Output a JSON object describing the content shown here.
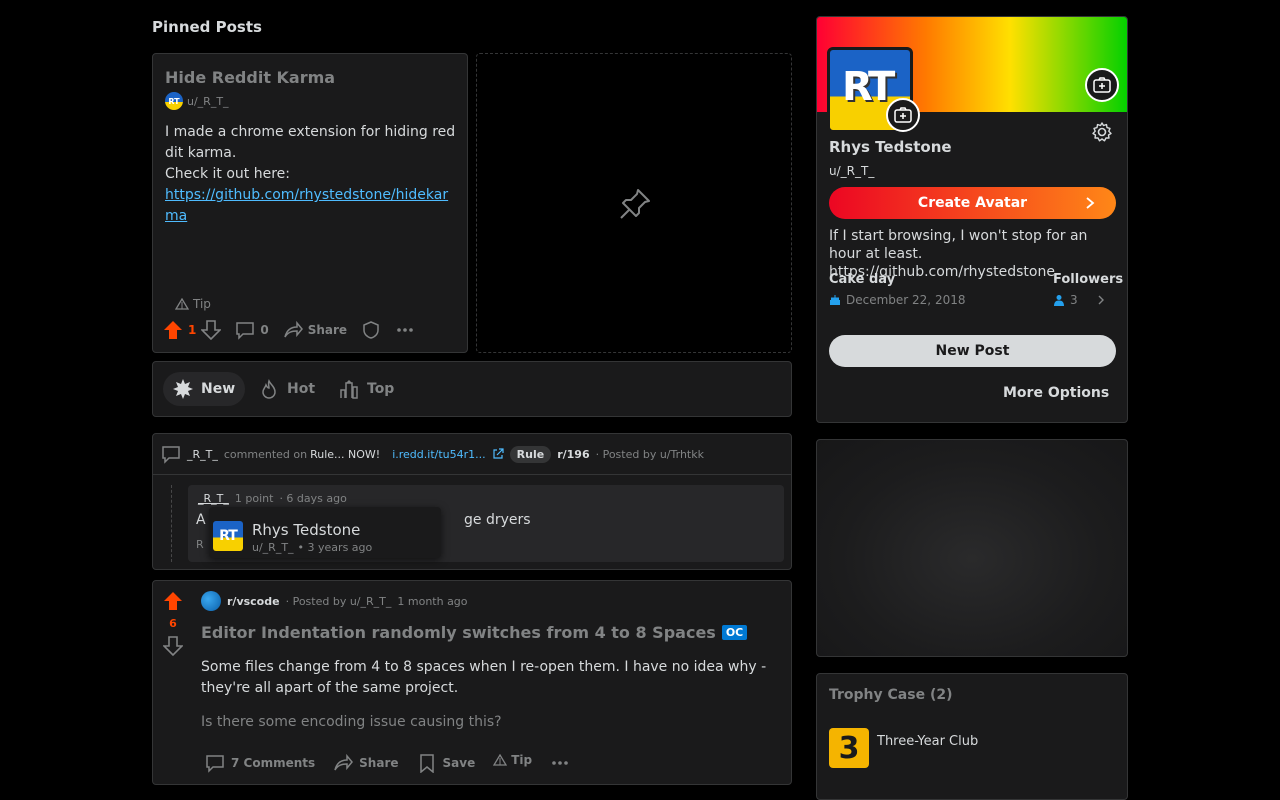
{
  "pinned": {
    "heading": "Pinned Posts",
    "post": {
      "title": "Hide Reddit Karma",
      "author": "u/_R_T_",
      "body_line1": "I made a chrome extension for hiding reddit karma.",
      "body_line2": "Check it out here:",
      "link": "https://github.com/rhystedstone/hidekarma",
      "tip_label": "Tip",
      "votes": "1",
      "comments": "0",
      "share_label": "Share"
    }
  },
  "sort": {
    "items": [
      {
        "label": "New"
      },
      {
        "label": "Hot"
      },
      {
        "label": "Top"
      }
    ]
  },
  "comment_card": {
    "user": "_R_T_",
    "commented_on": "commented on",
    "post_title": "Rule... NOW!",
    "link": "i.redd.it/tu54r1...",
    "flair": "Rule",
    "subreddit": "r/196",
    "posted_by": "· Posted by u/Trhtkk",
    "comment_user": "_R_T_",
    "comment_points": "1 point",
    "comment_time": "· 6 days ago",
    "comment_text_start": "A",
    "comment_text_end": "ge dryers",
    "comment_reply_initial": "R",
    "hover": {
      "name": "Rhys Tedstone",
      "username": "u/_R_T_",
      "age": "• 3 years ago"
    }
  },
  "post": {
    "votes": "6",
    "subreddit": "r/vscode",
    "posted_by": "· Posted by u/_R_T_",
    "time": "1 month ago",
    "title": "Editor Indentation randomly switches from 4 to 8 Spaces",
    "flair": "OC",
    "body1": "Some files change from 4 to 8 spaces when I re-open them. I have no idea why - they're all apart of the same project.",
    "body2": "Is there some encoding issue causing this?",
    "comments_label": "7 Comments",
    "share_label": "Share",
    "save_label": "Save",
    "tip_label": "Tip"
  },
  "profile": {
    "avatar_text": "RT",
    "name": "Rhys Tedstone",
    "username": "u/_R_T_",
    "create_avatar": "Create Avatar",
    "bio": "If I start browsing, I won't stop for an hour at least. https://github.com/rhystedstone",
    "cake_day_label": "Cake day",
    "cake_day": "December 22, 2018",
    "followers_label": "Followers",
    "followers": "3",
    "new_post": "New Post",
    "more_options": "More Options"
  },
  "trophy": {
    "heading": "Trophy Case (2)",
    "items": [
      {
        "name": "Three-Year Club",
        "badge": "3"
      }
    ]
  },
  "colors": {
    "upvote": "#ff4500",
    "link": "#4fbcff",
    "oc_badge": "#0079d3"
  }
}
